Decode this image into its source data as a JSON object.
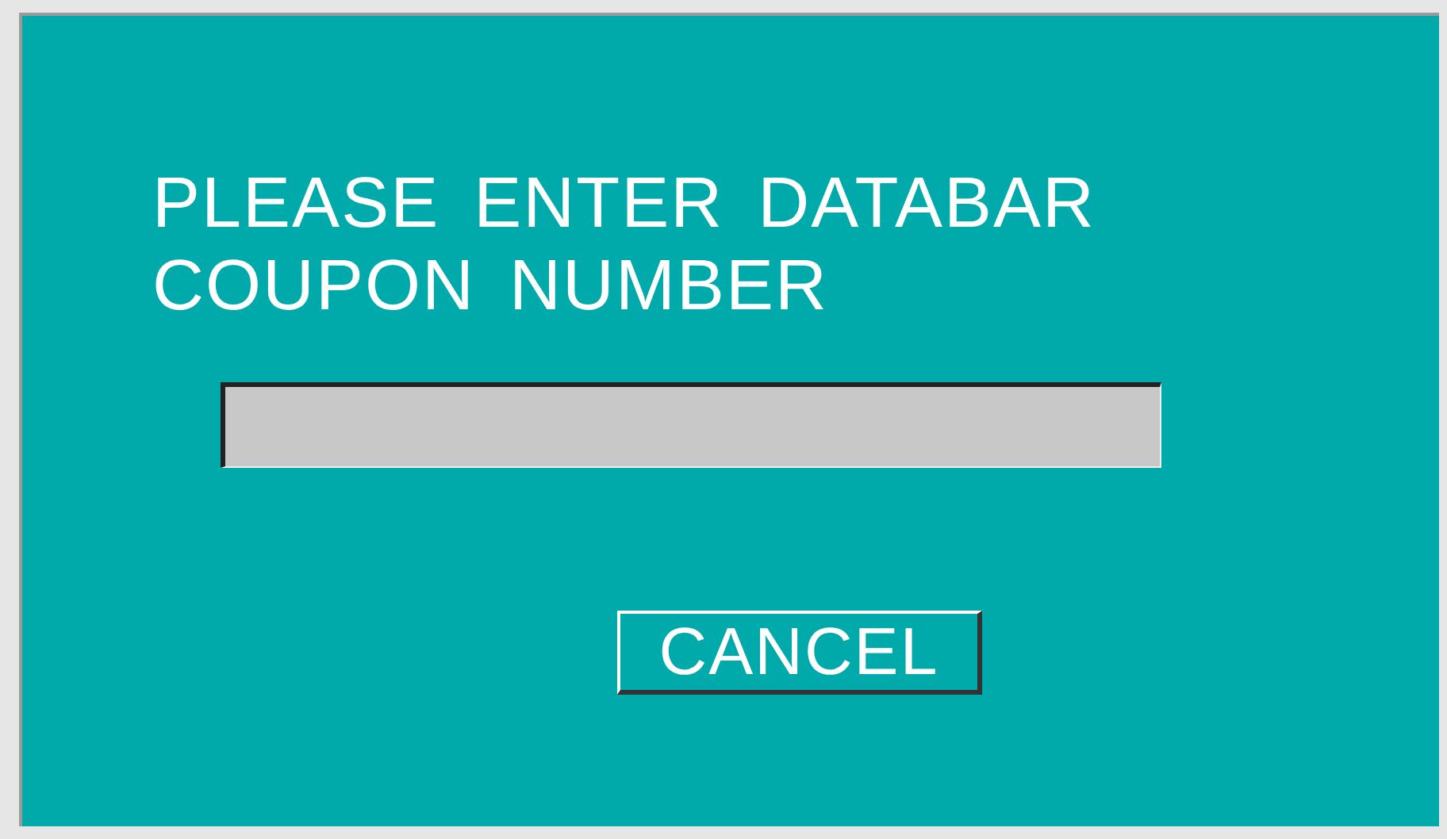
{
  "prompt": {
    "lines": [
      "PLEASE ENTER DATABAR",
      "COUPON NUMBER"
    ]
  },
  "buttons": [
    {
      "label": "CANCEL"
    }
  ]
}
